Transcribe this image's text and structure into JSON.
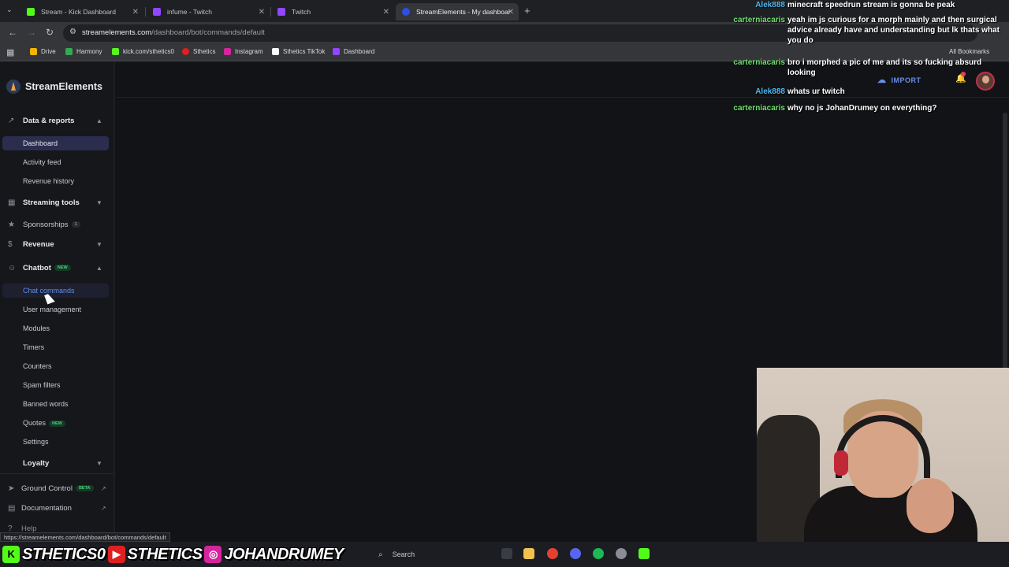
{
  "browser": {
    "tabs": [
      {
        "title": "Stream - Kick Dashboard",
        "color": "#53fc18"
      },
      {
        "title": "infume - Twitch",
        "color": "#9146ff"
      },
      {
        "title": "Twitch",
        "color": "#9146ff"
      },
      {
        "title": "StreamElements - My dashboar",
        "color": "#2b50e0"
      }
    ],
    "url_host": "streamelements.com",
    "url_path": "/dashboard/bot/commands/default",
    "bookmarks": [
      {
        "label": "Drive",
        "color": "#f4b400"
      },
      {
        "label": "Harmony",
        "color": "#34a853"
      },
      {
        "label": "kick.com/sthetics0",
        "color": "#53fc18"
      },
      {
        "label": "Sthetics",
        "color": "#e02020"
      },
      {
        "label": "Instagram",
        "color": "#d6249f"
      },
      {
        "label": "Sthetics TikTok",
        "color": "#ffffff"
      },
      {
        "label": "Dashboard",
        "color": "#9146ff"
      }
    ],
    "all_bookmarks": "All Bookmarks"
  },
  "app": {
    "logo_text": "StreamElements",
    "import_label": "IMPORT",
    "notification_count": "1"
  },
  "sidebar": {
    "data_reports": "Data & reports",
    "dashboard": "Dashboard",
    "activity_feed": "Activity feed",
    "revenue_history": "Revenue history",
    "streaming_tools": "Streaming tools",
    "sponsorships": "Sponsorships",
    "sponsorships_count": "1",
    "revenue": "Revenue",
    "chatbot": "Chatbot",
    "chatbot_badge": "NEW",
    "chat_commands": "Chat commands",
    "user_management": "User management",
    "modules": "Modules",
    "timers": "Timers",
    "counters": "Counters",
    "spam_filters": "Spam filters",
    "banned_words": "Banned words",
    "quotes": "Quotes",
    "quotes_badge": "NEW",
    "settings": "Settings",
    "loyalty": "Loyalty",
    "ground_control": "Ground Control",
    "ground_control_badge": "BETA",
    "documentation": "Documentation",
    "help": "Help"
  },
  "status_url": "https://streamelements.com/dashboard/bot/commands/default",
  "taskbar": {
    "search": "Search"
  },
  "chat": [
    {
      "user": "Alek888",
      "color": "#4fb8f0",
      "text": "minecraft speedrun stream is gonna be peak"
    },
    {
      "user": "carterniacaris",
      "color": "#6fe06f",
      "text": "yeah im js curious for a morph mainly and then surgical advice already have and understanding but lk thats what you do"
    },
    {
      "user": "carterniacaris",
      "color": "#6fe06f",
      "text": "bro i morphed a pic of me and its so fucking absurd looking"
    },
    {
      "user": "Alek888",
      "color": "#4fb8f0",
      "text": "whats ur twitch"
    },
    {
      "user": "carterniacaris",
      "color": "#6fe06f",
      "text": "why no js JohanDrumey on everything?"
    }
  ],
  "banner": {
    "kick": "STHETICS0",
    "youtube": "STHETICS",
    "instagram": "JOHANDRUMEY"
  }
}
